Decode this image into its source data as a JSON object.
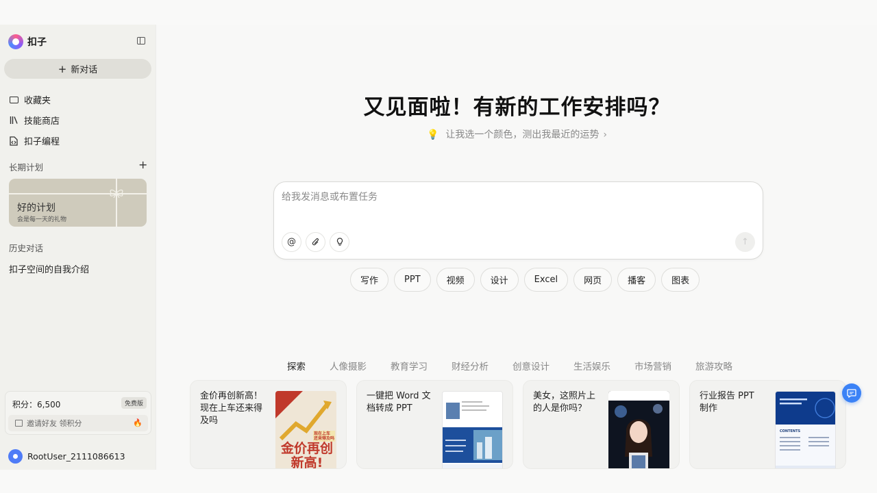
{
  "sidebar": {
    "app_name": "扣子",
    "new_chat_label": "新对话",
    "nav": [
      {
        "label": "收藏夹",
        "icon": "folder-icon"
      },
      {
        "label": "技能商店",
        "icon": "library-icon"
      },
      {
        "label": "扣子编程",
        "icon": "code-file-icon"
      }
    ],
    "plans_label": "长期计划",
    "plan_card": {
      "title": "好的计划",
      "subtitle": "会是每一天的礼物"
    },
    "history_label": "历史对话",
    "history": [
      "扣子空间的自我介绍"
    ],
    "points_text": "积分：6,500",
    "plan_badge": "免费版",
    "invite_text": "邀请好友 领积分",
    "user_name": "RootUser_2111086613"
  },
  "main": {
    "greeting": "又见面啦！有新的工作安排吗？",
    "suggestion": "让我选一个颜色，测出我最近的运势",
    "input_placeholder": "给我发消息或布置任务",
    "chips": [
      "写作",
      "PPT",
      "视频",
      "设计",
      "Excel",
      "网页",
      "播客",
      "图表"
    ],
    "category_tabs": [
      "探索",
      "人像摄影",
      "教育学习",
      "财经分析",
      "创意设计",
      "生活娱乐",
      "市场营销",
      "旅游攻略"
    ],
    "active_tab": "探索",
    "cards": [
      {
        "title": "金价再创新高！现在上车还来得及吗",
        "thumb_text": "金价再创新高!",
        "thumb_sub": "现在上车 还来得及吗"
      },
      {
        "title": "一键把 Word 文档转成 PPT"
      },
      {
        "title": "美女，这照片上的人是你吗？"
      },
      {
        "title": "行业报告 PPT 制作",
        "thumb_text": "CONTENTS"
      }
    ]
  },
  "colors": {
    "accent": "#3b82f6",
    "sidebar_bg": "#f1f1ed",
    "plan_card": "#cfcbbc"
  }
}
